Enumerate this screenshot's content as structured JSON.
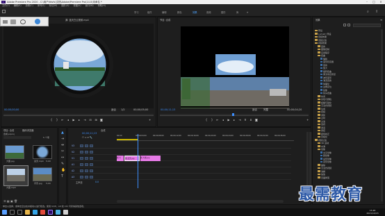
{
  "window": {
    "title": "Adobe Premiere Pro 2020 - C:\\用户\\fdsfs\\文档\\Adobe\\Premiere Pro\\14.0\\未命名 *",
    "app_icon": "Pr"
  },
  "menu": [
    "文件(F)",
    "编辑(E)",
    "剪辑(C)",
    "序列(S)",
    "标记(M)",
    "图形(G)",
    "视图(V)",
    "窗口(W)",
    "帮助(H)"
  ],
  "workspaces": [
    "学习",
    "组件",
    "编辑",
    "颜色",
    "效果",
    "音频",
    "图形",
    "库"
  ],
  "workspace_active": "效果",
  "source": {
    "tab": "源: 蓝天白云视频.mp4",
    "timecode_left": "00;00;00;00",
    "timecode_right": "00;00;05;00",
    "fit": "适合",
    "scale": "1/2"
  },
  "program": {
    "tab": "节目: 合成",
    "timecode_left": "00;00;11;13",
    "timecode_right": "00;00;04;20",
    "fit": "适合",
    "scale": "完整"
  },
  "project": {
    "tab": "项目: 合成",
    "tab2": "媒体浏览器",
    "file": "合成.prproj",
    "count": "5 个项",
    "items": [
      {
        "name": "大图.jpg",
        "dur": ""
      },
      {
        "name": "蓝天.mp4",
        "dur": "5;00"
      },
      {
        "name": "大图.mp4",
        "dur": ""
      },
      {
        "name": "背景.jpg",
        "dur": "5;00"
      }
    ]
  },
  "timeline": {
    "tab": "合成",
    "timecode": "00;00;11;13",
    "ruler": [
      "00;00",
      "00;00;04;00",
      "00;00;08;00",
      "00;00;12;00",
      "00;00;16;00",
      "00;00;20;00",
      "00;00;24;00",
      "00;00;28;00",
      "00;00;32;00",
      "00;00;36;00"
    ],
    "tracks": [
      "V3",
      "V2",
      "V1",
      "A1",
      "A2",
      "A3"
    ],
    "master": "主声道",
    "master_val": "0.0",
    "clips": [
      {
        "label": "图 大图.jpg"
      },
      {
        "label": "图 蓝天.jpg"
      },
      {
        "label": "图 大图.jpg"
      }
    ]
  },
  "effects": {
    "tab": "效果",
    "tree": [
      "预设",
      "Lumetri 预设",
      "音频效果",
      "音频过渡",
      "视频效果",
      "变换",
      "图像控制",
      "实用程序",
      "扭曲",
      "时间",
      "杂色与颗粒",
      "模糊与锐化",
      "沉浸式视频",
      "生成",
      "视频",
      "调整",
      "过时",
      "过渡",
      "透视",
      "通道",
      "键控",
      "颜色校正",
      "风格化",
      "视频过渡",
      "3D 运动",
      "内滑",
      "划像",
      "擦除",
      "沉浸式视频",
      "溶解",
      "缩放",
      "页面剥落"
    ]
  },
  "status": "单击以选择，或单击空白处并拖动以进行框选。使用 Shift、Alt 和 Ctrl 可获得其他选项。",
  "clock": {
    "time": "15:48",
    "date": "2021/10/15"
  },
  "watermark": "最需教育",
  "colors": {
    "accent": "#3d8fff",
    "clip_pink": "#e67ae6",
    "timeline_blue": "#2f5fae"
  }
}
